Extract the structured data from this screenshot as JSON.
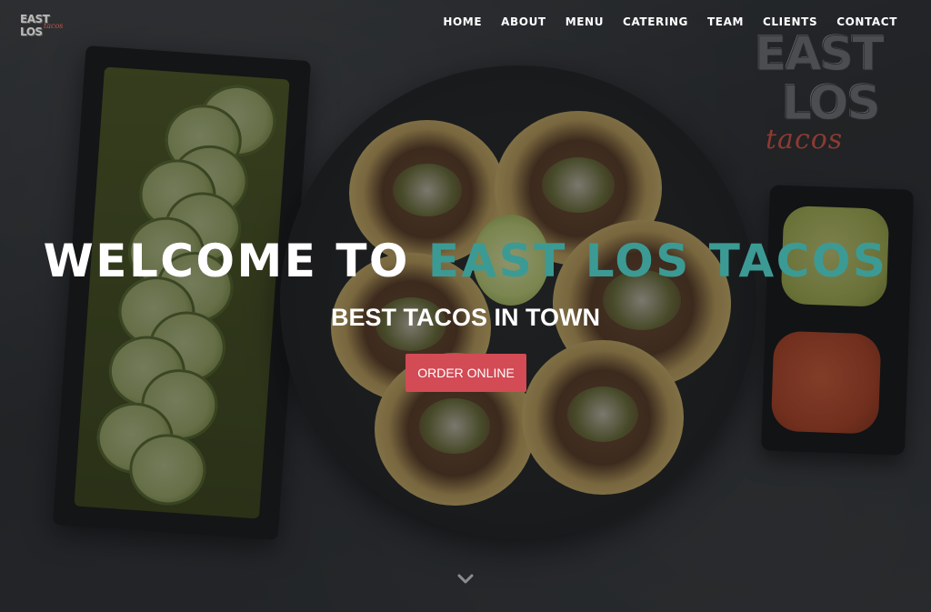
{
  "brand": {
    "logo_text_top": "EAST LOS",
    "logo_text_bottom": "tacos",
    "big_logo_line1": "EAST",
    "big_logo_line2": "LOS",
    "big_logo_line3": "tacos"
  },
  "nav": {
    "items": [
      {
        "label": "HOME"
      },
      {
        "label": "ABOUT"
      },
      {
        "label": "MENU"
      },
      {
        "label": "CATERING"
      },
      {
        "label": "TEAM"
      },
      {
        "label": "CLIENTS"
      },
      {
        "label": "CONTACT"
      }
    ]
  },
  "hero": {
    "title_prefix": "WELCOME TO ",
    "title_accent": "EAST LOS TACOS",
    "subtitle": "BEST TACOS IN TOWN",
    "button_label": "ORDER ONLINE",
    "scroll_icon": "chevron-down-icon"
  },
  "colors": {
    "accent": "#3c9a94",
    "button": "#d24b55",
    "text": "#ffffff"
  }
}
